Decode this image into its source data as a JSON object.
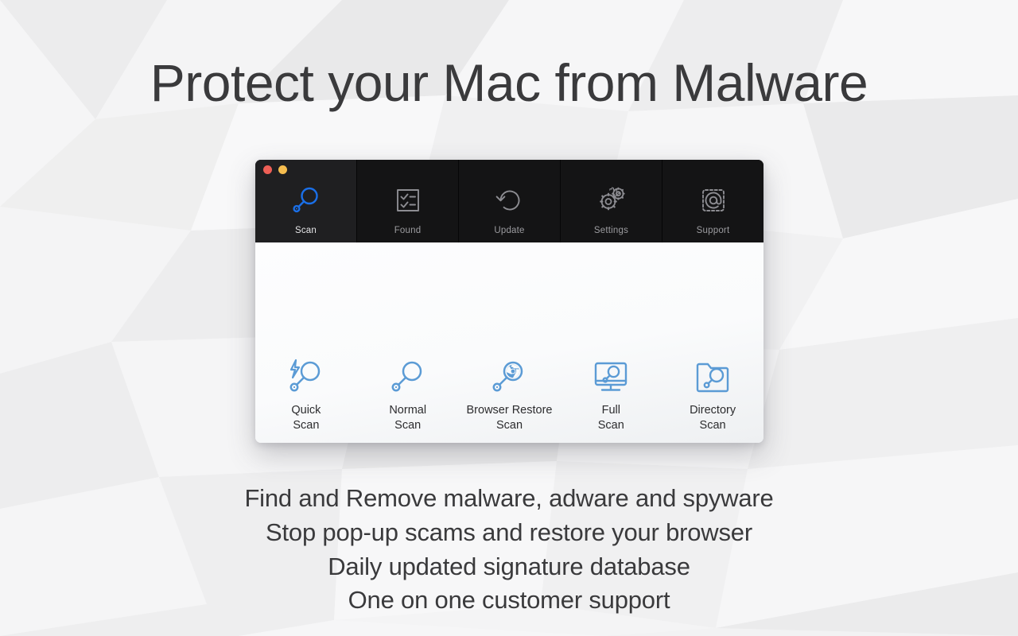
{
  "headline": "Protect your Mac from Malware",
  "window": {
    "traffic_lights": [
      {
        "name": "close",
        "color": "#ee5f56"
      },
      {
        "name": "minimize",
        "color": "#f5bd4f"
      }
    ],
    "toolbar": {
      "tabs": [
        {
          "label": "Scan",
          "icon": "magnifier-icon",
          "active": true
        },
        {
          "label": "Found",
          "icon": "checklist-icon",
          "active": false
        },
        {
          "label": "Update",
          "icon": "refresh-icon",
          "active": false
        },
        {
          "label": "Settings",
          "icon": "gears-icon",
          "active": false
        },
        {
          "label": "Support",
          "icon": "at-sign-icon",
          "active": false
        }
      ]
    },
    "scan_options": [
      {
        "label": "Quick\nScan",
        "icon": "bolt-magnifier-icon"
      },
      {
        "label": "Normal\nScan",
        "icon": "magnifier-icon"
      },
      {
        "label": "Browser Restore\nScan",
        "icon": "browser-magnifier-icon"
      },
      {
        "label": "Full\nScan",
        "icon": "monitor-magnifier-icon"
      },
      {
        "label": "Directory\nScan",
        "icon": "folder-magnifier-icon"
      }
    ]
  },
  "taglines": [
    "Find and Remove malware, adware and spyware",
    "Stop pop-up scams and restore your browser",
    "Daily updated signature database",
    "One on one customer support"
  ],
  "colors": {
    "accent_blue": "#5b9bd5",
    "active_icon_blue": "#1a6fe8",
    "toolbar_bg": "#141415",
    "active_tab_bg": "#1f1f21",
    "text_dark": "#3a3a3c",
    "tab_label_inactive": "#9c9ca0"
  }
}
